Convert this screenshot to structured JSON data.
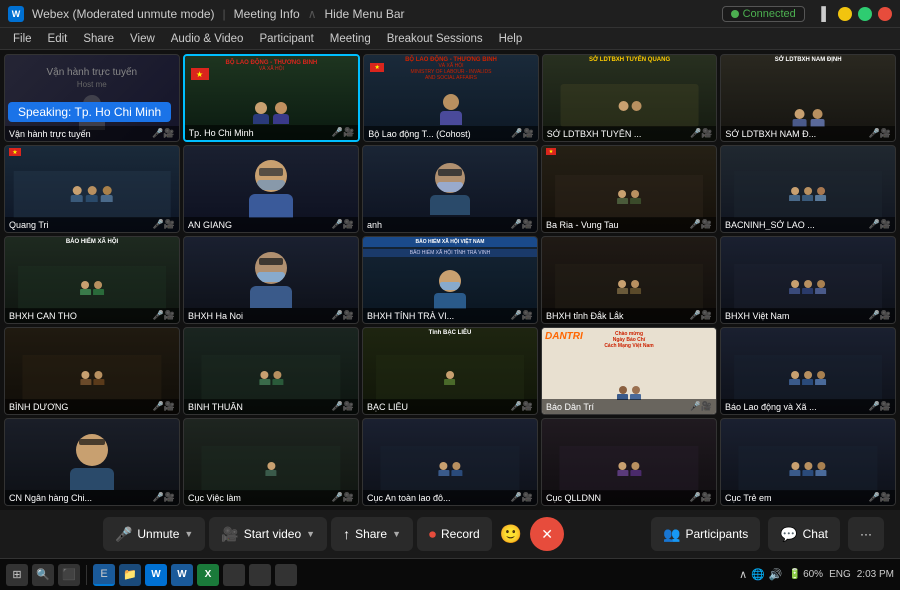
{
  "titlebar": {
    "app_name": "Webex (Moderated unmute mode)",
    "sep": "|",
    "meeting_info": "Meeting Info",
    "hide_menu": "Hide Menu Bar",
    "connected": "Connected",
    "controls": [
      "minimize",
      "maximize",
      "close"
    ]
  },
  "menubar": {
    "items": [
      "File",
      "Edit",
      "Share",
      "View",
      "Audio & Video",
      "Participant",
      "Meeting",
      "Breakout Sessions",
      "Help"
    ]
  },
  "speaking_banner": "Speaking: Tp. Ho Chi Minh",
  "video_grid": {
    "rows": [
      [
        {
          "label": "Vận hành trực tuyến",
          "sublabel": "Host me",
          "type": "dark",
          "active": false
        },
        {
          "label": "Tp. Ho Chi Minh",
          "type": "active_speaker",
          "active": true
        },
        {
          "label": "Bộ Lao động T... (Cohost)",
          "type": "office",
          "active": false
        },
        {
          "label": "SỞ LDTBXH TUYÊN ...",
          "type": "room",
          "active": false
        },
        {
          "label": "SỞ LDTBXH NAM Đ...",
          "type": "room",
          "active": false
        }
      ],
      [
        {
          "label": "Quang Tri",
          "type": "room",
          "active": false
        },
        {
          "label": "AN GIANG",
          "type": "person_close",
          "active": false
        },
        {
          "label": "anh",
          "type": "person_mask",
          "active": false
        },
        {
          "label": "Ba Ria - Vung Tau",
          "type": "room",
          "active": false
        },
        {
          "label": "BACNINH_SỞ LAO ...",
          "type": "room",
          "active": false
        }
      ],
      [
        {
          "label": "BHXH CAN THO",
          "type": "room",
          "active": false
        },
        {
          "label": "BHXH Ha Noi",
          "type": "person_close2",
          "active": false
        },
        {
          "label": "BHXH TỈNH TRÀ VI...",
          "type": "bhxh",
          "active": false
        },
        {
          "label": "BHXH tỉnh Đắk Lắk",
          "type": "room",
          "active": false
        },
        {
          "label": "BHXH Việt Nam",
          "type": "room",
          "active": false
        }
      ],
      [
        {
          "label": "BÌNH DƯƠNG",
          "type": "room",
          "active": false
        },
        {
          "label": "BINH THUÂN",
          "type": "room",
          "active": false
        },
        {
          "label": "BẠC LIÊU",
          "type": "baclieu",
          "active": false
        },
        {
          "label": "Báo Dân Trí",
          "type": "dantri",
          "active": false
        },
        {
          "label": "Báo Lao động và Xã ...",
          "type": "room",
          "active": false
        }
      ],
      [
        {
          "label": "CN Ngân hàng Chi...",
          "type": "person_ngân",
          "active": false
        },
        {
          "label": "Cục Việc làm",
          "type": "room",
          "active": false
        },
        {
          "label": "Cục An toàn lao đô...",
          "type": "room",
          "active": false
        },
        {
          "label": "Cục QLLDNN",
          "type": "room",
          "active": false
        },
        {
          "label": "Cục Trẻ em",
          "type": "room",
          "active": false
        }
      ]
    ]
  },
  "toolbar": {
    "unmute_label": "Unmute",
    "start_video_label": "Start video",
    "share_label": "Share",
    "record_label": "Record",
    "end_label": "✕",
    "participants_label": "Participants",
    "chat_label": "Chat",
    "more_label": "···"
  },
  "taskbar": {
    "time": "2:03 PM",
    "language": "ENG",
    "battery": "60%",
    "icons": [
      "⊞",
      "🔍",
      "⬛",
      "⬛",
      "⬛",
      "⬛",
      "⬛",
      "⬛",
      "⬛",
      "⬛",
      "⬛",
      "⬛"
    ]
  }
}
